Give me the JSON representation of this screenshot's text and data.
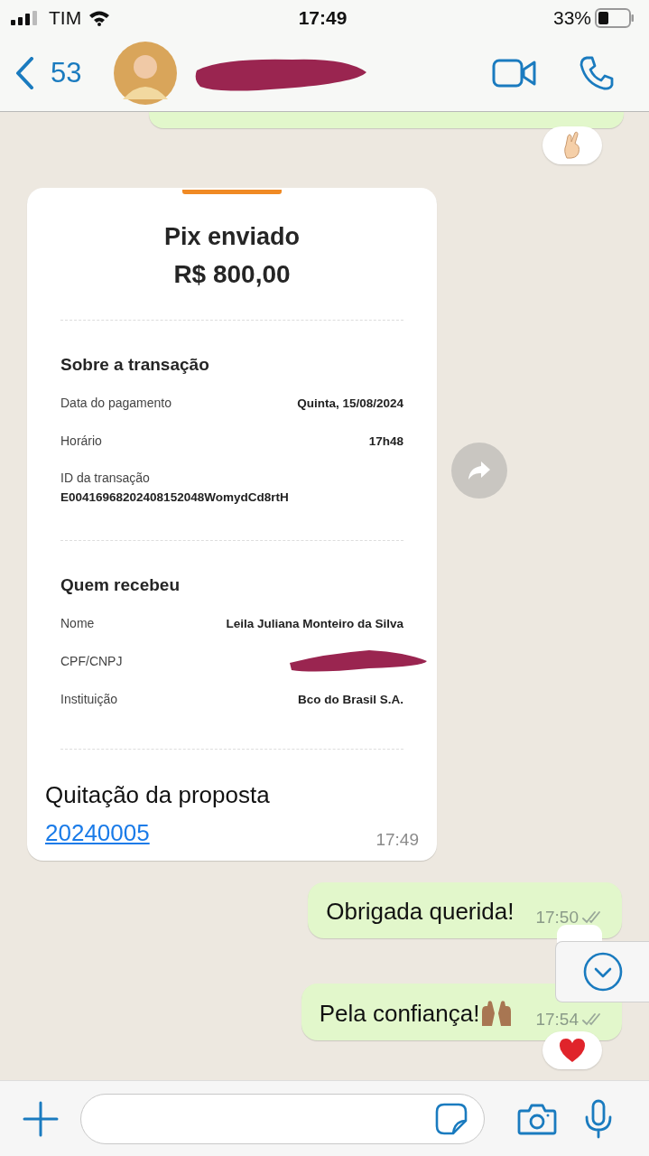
{
  "status_bar": {
    "carrier": "TIM",
    "time": "17:49",
    "battery": "33%"
  },
  "header": {
    "back_count": "53"
  },
  "messages": [
    {
      "kind": "receipt",
      "receipt": {
        "title": "Pix enviado",
        "amount": "R$ 800,00",
        "sections": [
          {
            "heading": "Sobre a transação",
            "rows": [
              {
                "kind": "inline",
                "label": "Data do pagamento",
                "value": "Quinta, 15/08/2024"
              },
              {
                "kind": "inline",
                "label": "Horário",
                "value": "17h48"
              },
              {
                "kind": "stacked",
                "label": "ID da transação",
                "value": "E0041696820240815204​8WomydCd8rtH"
              }
            ]
          },
          {
            "heading": "Quem recebeu",
            "rows": [
              {
                "kind": "inline",
                "label": "Nome",
                "value": "Leila Juliana Monteiro da Silva"
              },
              {
                "kind": "redacted",
                "label": "CPF/CNPJ"
              },
              {
                "kind": "inline",
                "label": "Instituição",
                "value": "Bco do Brasil S.A."
              }
            ]
          }
        ]
      },
      "caption": "Quitação da proposta",
      "link": "20240005",
      "time": "17:49"
    },
    {
      "kind": "outgoing",
      "text": "Obrigada querida!",
      "time": "17:50",
      "read": false
    },
    {
      "kind": "outgoing_emoji",
      "text": "Pela confiança!",
      "time": "17:54",
      "read": false
    }
  ]
}
